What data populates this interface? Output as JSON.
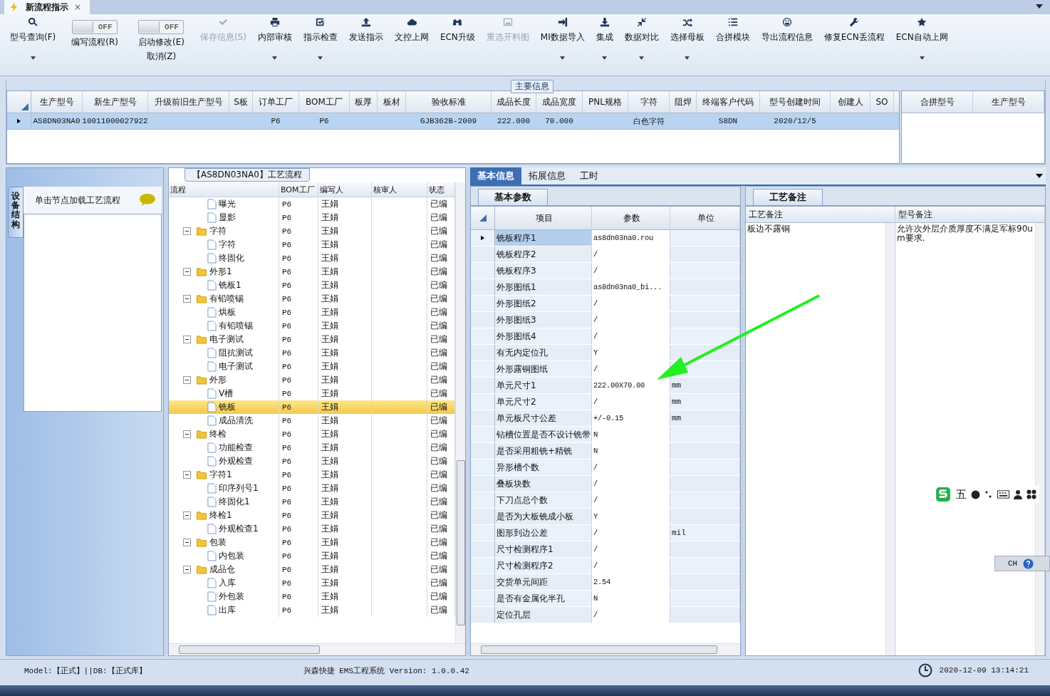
{
  "title_tab": {
    "label": "新流程指示",
    "close": "×"
  },
  "toolbar": [
    {
      "kind": "button",
      "label": "型号查询(F)",
      "dropdown": true,
      "disabled": false
    },
    {
      "kind": "toggle",
      "label": "编写流程(R)",
      "state_text": "OFF",
      "on": false
    },
    {
      "kind": "toggle",
      "label": "启动修改(E)",
      "sublabel": "取消(Z)",
      "state_text": "OFF",
      "on": false
    },
    {
      "kind": "button",
      "label": "保存信息(S)",
      "dropdown": false,
      "disabled": true
    },
    {
      "kind": "button",
      "label": "内部审核",
      "dropdown": true,
      "disabled": false
    },
    {
      "kind": "button",
      "label": "指示检查",
      "dropdown": true,
      "disabled": false
    },
    {
      "kind": "button",
      "label": "发送指示",
      "dropdown": false,
      "disabled": false
    },
    {
      "kind": "button",
      "label": "文控上网",
      "dropdown": false,
      "disabled": false
    },
    {
      "kind": "button",
      "label": "ECN升级",
      "dropdown": false,
      "disabled": false
    },
    {
      "kind": "button",
      "label": "重选开料图",
      "dropdown": false,
      "disabled": true
    },
    {
      "kind": "button",
      "label": "MI数据导入",
      "dropdown": true,
      "disabled": false
    },
    {
      "kind": "button",
      "label": "集成",
      "dropdown": true,
      "disabled": false
    },
    {
      "kind": "button",
      "label": "数据对比",
      "dropdown": true,
      "disabled": false
    },
    {
      "kind": "button",
      "label": "选择母板",
      "dropdown": true,
      "disabled": false
    },
    {
      "kind": "button",
      "label": "合拼模块",
      "dropdown": false,
      "disabled": false
    },
    {
      "kind": "button",
      "label": "导出流程信息",
      "dropdown": false,
      "disabled": false
    },
    {
      "kind": "button",
      "label": "修复ECN丢流程",
      "dropdown": false,
      "disabled": false
    },
    {
      "kind": "button",
      "label": "ECN自动上网",
      "dropdown": true,
      "disabled": false
    }
  ],
  "main_info": {
    "legend": "主要信息",
    "columns": [
      "生产型号",
      "新生产型号",
      "升级前旧生产型号",
      "S板",
      "订单工厂",
      "BOM工厂",
      "板厚",
      "板材",
      "验收标准",
      "成品长度",
      "成品宽度",
      "PNL规格",
      "字符",
      "阻焊",
      "终端客户代码",
      "型号创建时间",
      "创建人",
      "SO"
    ],
    "rows": [
      {
        "selected": true,
        "cells": [
          "AS8DN03NA0",
          "10011000027922",
          null,
          null,
          "P6",
          "P6",
          null,
          null,
          "GJB362B-2009",
          "222.000",
          "70.000",
          null,
          "白色字符",
          null,
          "S8DN",
          "2020/12/5",
          null,
          null
        ]
      }
    ],
    "side_columns": [
      "合拼型号",
      "生产型号"
    ]
  },
  "left_panel": {
    "vertical_tab": "设备结构",
    "hint": "单击节点加载工艺流程"
  },
  "process": {
    "title": "【AS8DN03NA0】工艺流程",
    "columns": [
      "流程",
      "BOM工厂",
      "编写人",
      "核审人",
      "状态"
    ],
    "rows": [
      {
        "children": [
          {
            "label": "曝光",
            "bom": "P6",
            "writer": "王娟",
            "status": "已编",
            "selected": false
          },
          {
            "label": "显影",
            "bom": "P6",
            "writer": "王娟",
            "status": "已编",
            "selected": false
          }
        ]
      },
      {
        "label": "字符",
        "bom": "P6",
        "writer": "王娟",
        "status": "已编",
        "selected": false,
        "expanded": true,
        "children": [
          {
            "label": "字符",
            "bom": "P6",
            "writer": "王娟",
            "status": "已编",
            "selected": false
          },
          {
            "label": "终固化",
            "bom": "P6",
            "writer": "王娟",
            "status": "已编",
            "selected": false
          }
        ]
      },
      {
        "label": "外形1",
        "bom": "P6",
        "writer": "王娟",
        "status": "已编",
        "selected": false,
        "expanded": true,
        "children": [
          {
            "label": "铣板1",
            "bom": "P6",
            "writer": "王娟",
            "status": "已编",
            "selected": false
          }
        ]
      },
      {
        "label": "有铅喷锡",
        "bom": "P6",
        "writer": "王娟",
        "status": "已编",
        "selected": false,
        "expanded": true,
        "children": [
          {
            "label": "烘板",
            "bom": "P6",
            "writer": "王娟",
            "status": "已编",
            "selected": false
          },
          {
            "label": "有铅喷锡",
            "bom": "P6",
            "writer": "王娟",
            "status": "已编",
            "selected": false
          }
        ]
      },
      {
        "label": "电子测试",
        "bom": "P6",
        "writer": "王娟",
        "status": "已编",
        "selected": false,
        "expanded": true,
        "children": [
          {
            "label": "阻抗测试",
            "bom": "P6",
            "writer": "王娟",
            "status": "已编",
            "selected": false
          },
          {
            "label": "电子测试",
            "bom": "P6",
            "writer": "王娟",
            "status": "已编",
            "selected": false
          }
        ]
      },
      {
        "label": "外形",
        "bom": "P6",
        "writer": "王娟",
        "status": "已编",
        "selected": false,
        "expanded": true,
        "children": [
          {
            "label": "V槽",
            "bom": "P6",
            "writer": "王娟",
            "status": "已编",
            "selected": false
          },
          {
            "label": "铣板",
            "bom": "P6",
            "writer": "王娟",
            "status": "已编",
            "selected": true
          },
          {
            "label": "成品清洗",
            "bom": "P6",
            "writer": "王娟",
            "status": "已编",
            "selected": false
          }
        ]
      },
      {
        "label": "终检",
        "bom": "P6",
        "writer": "王娟",
        "status": "已编",
        "selected": false,
        "expanded": true,
        "children": [
          {
            "label": "功能检查",
            "bom": "P6",
            "writer": "王娟",
            "status": "已编",
            "selected": false
          },
          {
            "label": "外观检查",
            "bom": "P6",
            "writer": "王娟",
            "status": "已编",
            "selected": false
          }
        ]
      },
      {
        "label": "字符1",
        "bom": "P6",
        "writer": "王娟",
        "status": "已编",
        "selected": false,
        "expanded": true,
        "children": [
          {
            "label": "印序列号1",
            "bom": "P6",
            "writer": "王娟",
            "status": "已编",
            "selected": false
          },
          {
            "label": "终固化1",
            "bom": "P6",
            "writer": "王娟",
            "status": "已编",
            "selected": false
          }
        ]
      },
      {
        "label": "终检1",
        "bom": "P6",
        "writer": "王娟",
        "status": "已编",
        "selected": false,
        "expanded": true,
        "children": [
          {
            "label": "外观检查1",
            "bom": "P6",
            "writer": "王娟",
            "status": "已编",
            "selected": false
          }
        ]
      },
      {
        "label": "包装",
        "bom": "P6",
        "writer": "王娟",
        "status": "已编",
        "selected": false,
        "expanded": true,
        "children": [
          {
            "label": "内包装",
            "bom": "P6",
            "writer": "王娟",
            "status": "已编",
            "selected": false
          }
        ]
      },
      {
        "label": "成品仓",
        "bom": "P6",
        "writer": "王娟",
        "status": "已编",
        "selected": false,
        "expanded": true,
        "children": [
          {
            "label": "入库",
            "bom": "P6",
            "writer": "王娟",
            "status": "已编",
            "selected": false
          },
          {
            "label": "外包装",
            "bom": "P6",
            "writer": "王娟",
            "status": "已编",
            "selected": false
          },
          {
            "label": "出库",
            "bom": "P6",
            "writer": "王娟",
            "status": "已编",
            "selected": false
          }
        ]
      }
    ]
  },
  "detail": {
    "tabs": [
      {
        "label": "基本信息",
        "selected": true
      },
      {
        "label": "拓展信息",
        "selected": false
      },
      {
        "label": "工时",
        "selected": false
      }
    ],
    "subtab": "基本参数",
    "columns": [
      "项目",
      "参数",
      "单位"
    ],
    "rows": [
      {
        "item": "铣板程序1",
        "value": "as8dn03na0.rou",
        "selected": true
      },
      {
        "item": "铣板程序2",
        "value": "/",
        "selected": false
      },
      {
        "item": "铣板程序3",
        "value": "/",
        "selected": false
      },
      {
        "item": "外形图纸1",
        "value": "as8dn03na0_bi...",
        "selected": false
      },
      {
        "item": "外形图纸2",
        "value": "/",
        "selected": false
      },
      {
        "item": "外形图纸3",
        "value": "/",
        "selected": false
      },
      {
        "item": "外形图纸4",
        "value": "/",
        "selected": false
      },
      {
        "item": "有无内定位孔",
        "value": "Y",
        "selected": false
      },
      {
        "item": "外形露铜图纸",
        "value": "/",
        "selected": false
      },
      {
        "item": "单元尺寸1",
        "value": "222.00X70.00",
        "unit": "mm",
        "selected": false
      },
      {
        "item": "单元尺寸2",
        "value": "/",
        "unit": "mm",
        "selected": false
      },
      {
        "item": "单元板尺寸公差",
        "value": "+/-0.15",
        "unit": "mm",
        "selected": false
      },
      {
        "item": "钻槽位置是否不设计铣带",
        "value": "N",
        "selected": false
      },
      {
        "item": "是否采用粗铣+精铣",
        "value": "N",
        "selected": false
      },
      {
        "item": "异形槽个数",
        "value": "/",
        "selected": false
      },
      {
        "item": "叠板块数",
        "value": "/",
        "selected": false
      },
      {
        "item": "下刀点总个数",
        "value": "/",
        "selected": false
      },
      {
        "item": "是否为大板铣成小板",
        "value": "Y",
        "selected": false
      },
      {
        "item": "图形到边公差",
        "value": "/",
        "unit": "mil",
        "selected": false
      },
      {
        "item": "尺寸检测程序1",
        "value": "/",
        "selected": false
      },
      {
        "item": "尺寸检测程序2",
        "value": "/",
        "selected": false
      },
      {
        "item": "交货单元间距",
        "value": "2.54",
        "selected": false
      },
      {
        "item": "是否有金属化半孔",
        "value": "N",
        "selected": false
      },
      {
        "item": "定位孔层",
        "value": "/",
        "selected": false
      }
    ]
  },
  "remarks": {
    "tab": "工艺备注",
    "columns": [
      "工艺备注",
      "型号备注"
    ],
    "cells": [
      "板边不露铜",
      "允许次外层介质厚度不满足军标90um要求."
    ]
  },
  "ime": {
    "mode": "五",
    "lang": "CH"
  },
  "status_bar": {
    "model": "Model:【正式】||DB:【正式库】",
    "app": "兴森快捷 EMS工程系统 Version: 1.0.0.42",
    "time": "2020-12-09 13:14:21"
  }
}
